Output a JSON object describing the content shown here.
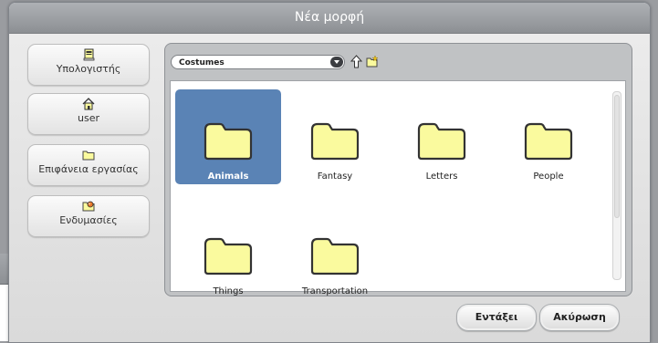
{
  "dialog": {
    "title": "Νέα μορφή",
    "ok_label": "Εντάξει",
    "cancel_label": "Ακύρωση"
  },
  "sidebar": {
    "items": [
      {
        "label": "Υπολογιστής",
        "icon": "computer-icon"
      },
      {
        "label": "user",
        "icon": "home-icon"
      },
      {
        "label": "Επιφάνεια εργασίας",
        "icon": "desktop-folder-icon"
      },
      {
        "label": "Ενδυμασίες",
        "icon": "costumes-icon"
      }
    ]
  },
  "browser": {
    "path": "Costumes",
    "items": [
      {
        "name": "Animals",
        "selected": true
      },
      {
        "name": "Fantasy",
        "selected": false
      },
      {
        "name": "Letters",
        "selected": false
      },
      {
        "name": "People",
        "selected": false
      },
      {
        "name": "Things",
        "selected": false
      },
      {
        "name": "Transportation",
        "selected": false
      }
    ]
  },
  "colors": {
    "selection": "#5a83b5",
    "folder_fill": "#fafa9e",
    "titlebar": "#9d9fa3"
  }
}
